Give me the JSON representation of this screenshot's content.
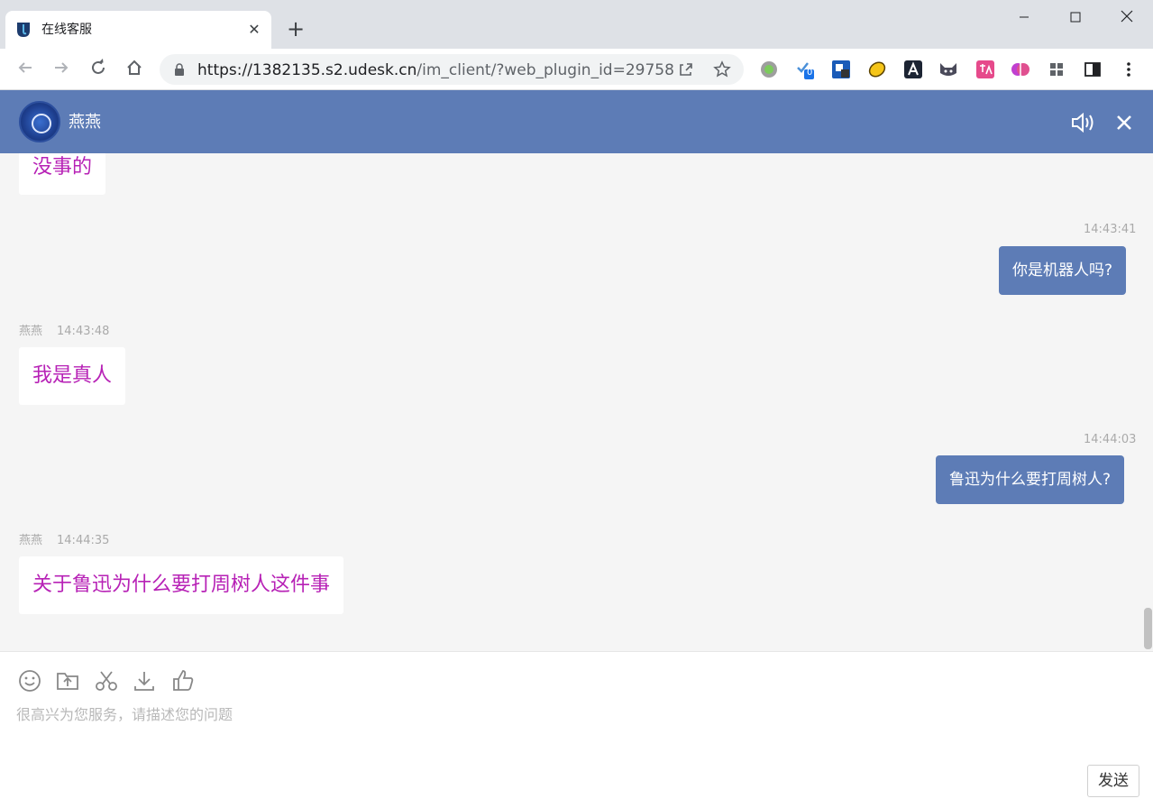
{
  "browser": {
    "tab_title": "在线客服",
    "tab_close": "✕",
    "new_tab": "+",
    "url_host": "https://1382135.s2.udesk.cn",
    "url_path": "/im_client/?web_plugin_id=29758",
    "extension_badge": "0"
  },
  "chat": {
    "agent_name": "燕燕",
    "messages": [
      {
        "side": "left",
        "text": "没事的"
      },
      {
        "side": "right",
        "time": "14:43:41",
        "text": "你是机器人吗?"
      },
      {
        "side": "left",
        "name": "燕燕",
        "time": "14:43:48",
        "text": "我是真人"
      },
      {
        "side": "right",
        "time": "14:44:03",
        "text": "鲁迅为什么要打周树人?"
      },
      {
        "side": "left",
        "name": "燕燕",
        "time": "14:44:35",
        "text": "关于鲁迅为什么要打周树人这件事"
      }
    ]
  },
  "input": {
    "placeholder": "很高兴为您服务，请描述您的问题",
    "send_label": "发送"
  },
  "colors": {
    "header": "#5d7cb6",
    "agent_text": "#b722b6",
    "user_bubble": "#5d7cb6"
  }
}
